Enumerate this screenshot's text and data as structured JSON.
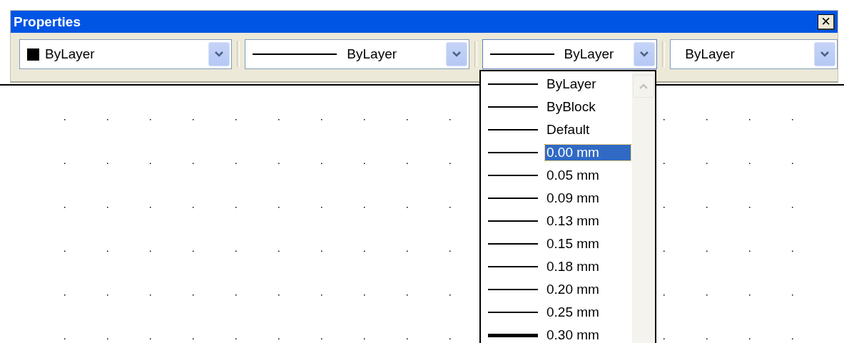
{
  "window": {
    "title": "Properties",
    "close": "✕"
  },
  "combos": [
    {
      "kind": "color",
      "color": "#000000",
      "value": "ByLayer",
      "open": false
    },
    {
      "kind": "line",
      "value": "ByLayer",
      "open": false
    },
    {
      "kind": "line",
      "value": "ByLayer",
      "open": true
    },
    {
      "kind": "plain",
      "value": "ByLayer",
      "open": false
    }
  ],
  "dropdown": {
    "items": [
      {
        "label": "ByLayer",
        "kind": "thin",
        "selected": false
      },
      {
        "label": "ByBlock",
        "kind": "thin",
        "selected": false
      },
      {
        "label": "Default",
        "kind": "thin",
        "selected": false
      },
      {
        "label": "0.00 mm",
        "kind": "thin",
        "selected": true
      },
      {
        "label": "0.05 mm",
        "kind": "thin",
        "selected": false
      },
      {
        "label": "0.09 mm",
        "kind": "thin",
        "selected": false
      },
      {
        "label": "0.13 mm",
        "kind": "thin",
        "selected": false
      },
      {
        "label": "0.15 mm",
        "kind": "thin",
        "selected": false
      },
      {
        "label": "0.18 mm",
        "kind": "thin",
        "selected": false
      },
      {
        "label": "0.20 mm",
        "kind": "thin",
        "selected": false
      },
      {
        "label": "0.25 mm",
        "kind": "thin",
        "selected": false
      },
      {
        "label": "0.30 mm",
        "kind": "thick",
        "selected": false
      }
    ]
  }
}
